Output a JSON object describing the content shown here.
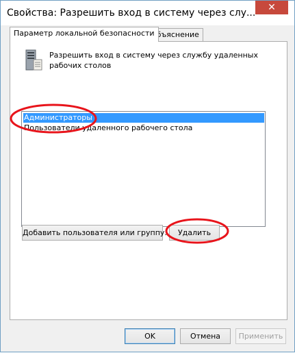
{
  "window": {
    "title": "Свойства: Разрешить вход в систему через слу...",
    "close_label": "✕"
  },
  "tabs": [
    {
      "label": "Параметр локальной безопасности",
      "active": true
    },
    {
      "label": "Объяснение",
      "active": false
    }
  ],
  "policy": {
    "icon": "server-icon",
    "text": "Разрешить вход в систему через службу удаленных рабочих столов"
  },
  "list": {
    "items": [
      {
        "label": "Администраторы",
        "selected": true
      },
      {
        "label": "Пользователи удаленного рабочего стола",
        "selected": false
      }
    ]
  },
  "buttons": {
    "add": "Добавить пользователя или группу...",
    "remove": "Удалить"
  },
  "footer": {
    "ok": "OK",
    "cancel": "Отмена",
    "apply": "Применить"
  },
  "colors": {
    "selection": "#3399ff",
    "annotation": "#e8141b",
    "close": "#c7493c"
  }
}
